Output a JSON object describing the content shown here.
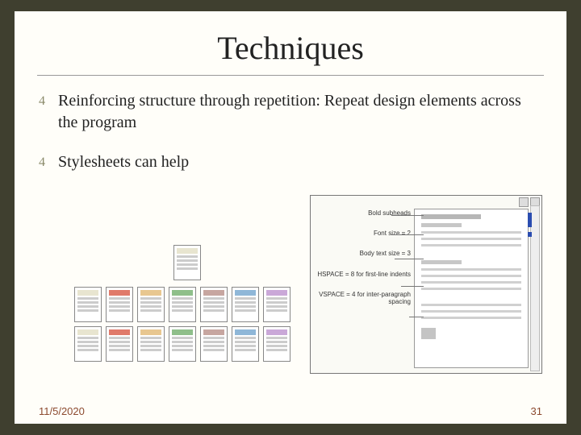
{
  "title": "Techniques",
  "bullets": [
    "Reinforcing structure through repetition: Repeat design elements across the program",
    "Stylesheets can help"
  ],
  "footer": {
    "date": "11/5/2020",
    "page": "31"
  },
  "fig_right_labels": [
    "Bold subheads",
    "Font size = 2",
    "Body text size = 3",
    "HSPACE = 8 for first-line indents",
    "VSPACE = 4 for inter-paragraph spacing"
  ]
}
